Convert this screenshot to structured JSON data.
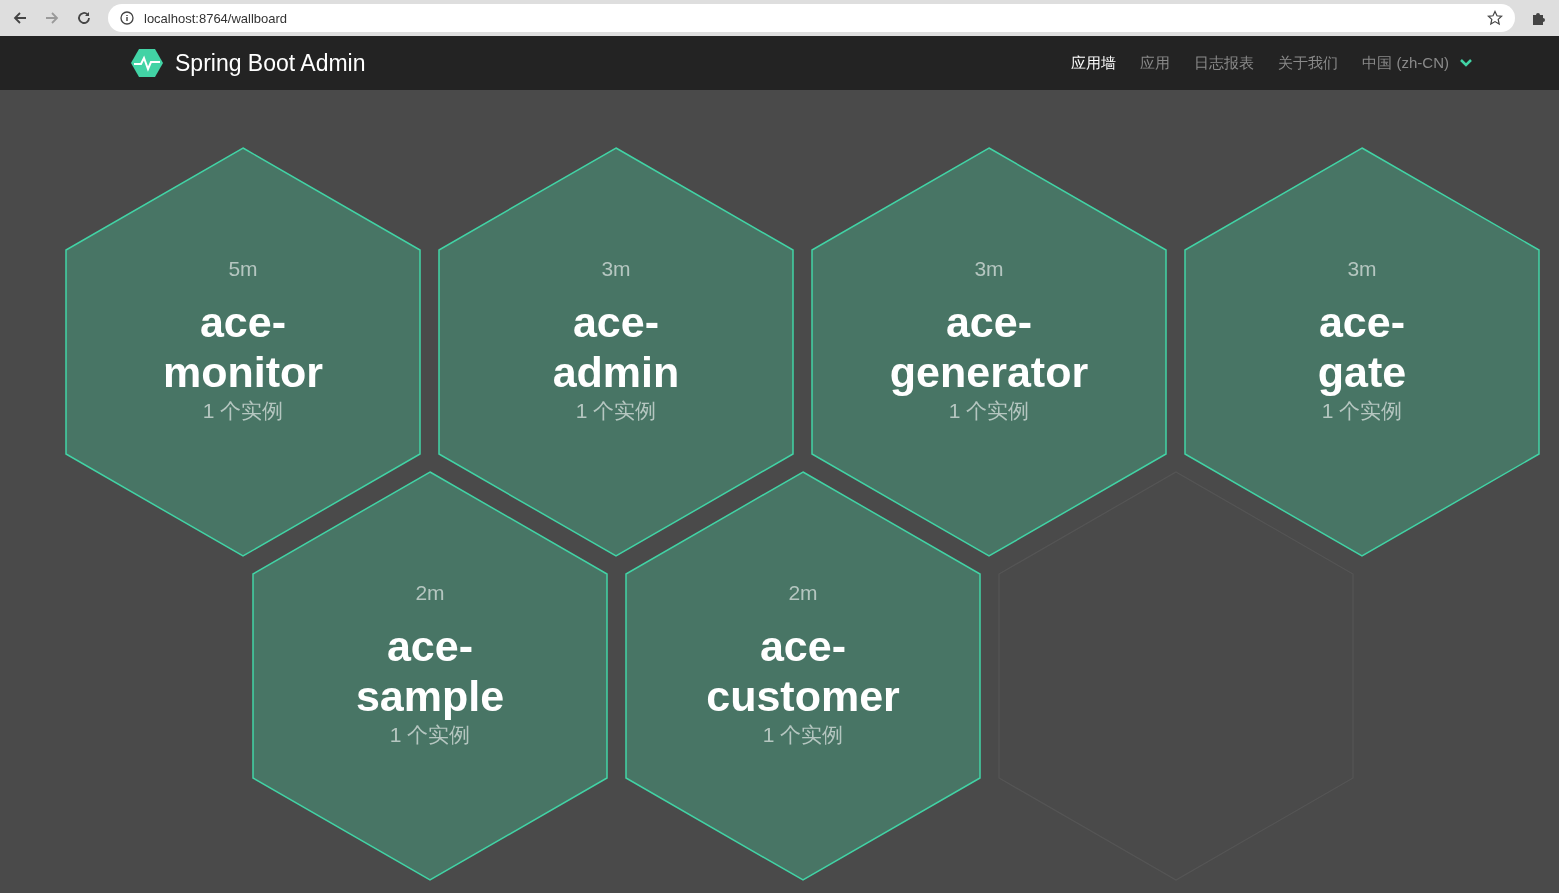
{
  "browser": {
    "url": "localhost:8764/wallboard"
  },
  "navbar": {
    "brand": "Spring Boot Admin",
    "items": [
      {
        "label": "应用墙",
        "selected": true
      },
      {
        "label": "应用",
        "selected": false
      },
      {
        "label": "日志报表",
        "selected": false
      },
      {
        "label": "关于我们",
        "selected": false
      }
    ],
    "language": "中国 (zh-CN)"
  },
  "tiles": [
    {
      "uptime": "5m",
      "name": "ace-monitor",
      "instances": "1 个实例"
    },
    {
      "uptime": "3m",
      "name": "ace-admin",
      "instances": "1 个实例"
    },
    {
      "uptime": "3m",
      "name": "ace-generator",
      "instances": "1 个实例"
    },
    {
      "uptime": "3m",
      "name": "ace-gate",
      "instances": "1 个实例"
    },
    {
      "uptime": "2m",
      "name": "ace-sample",
      "instances": "1 个实例"
    },
    {
      "uptime": "2m",
      "name": "ace-customer",
      "instances": "1 个实例"
    }
  ]
}
